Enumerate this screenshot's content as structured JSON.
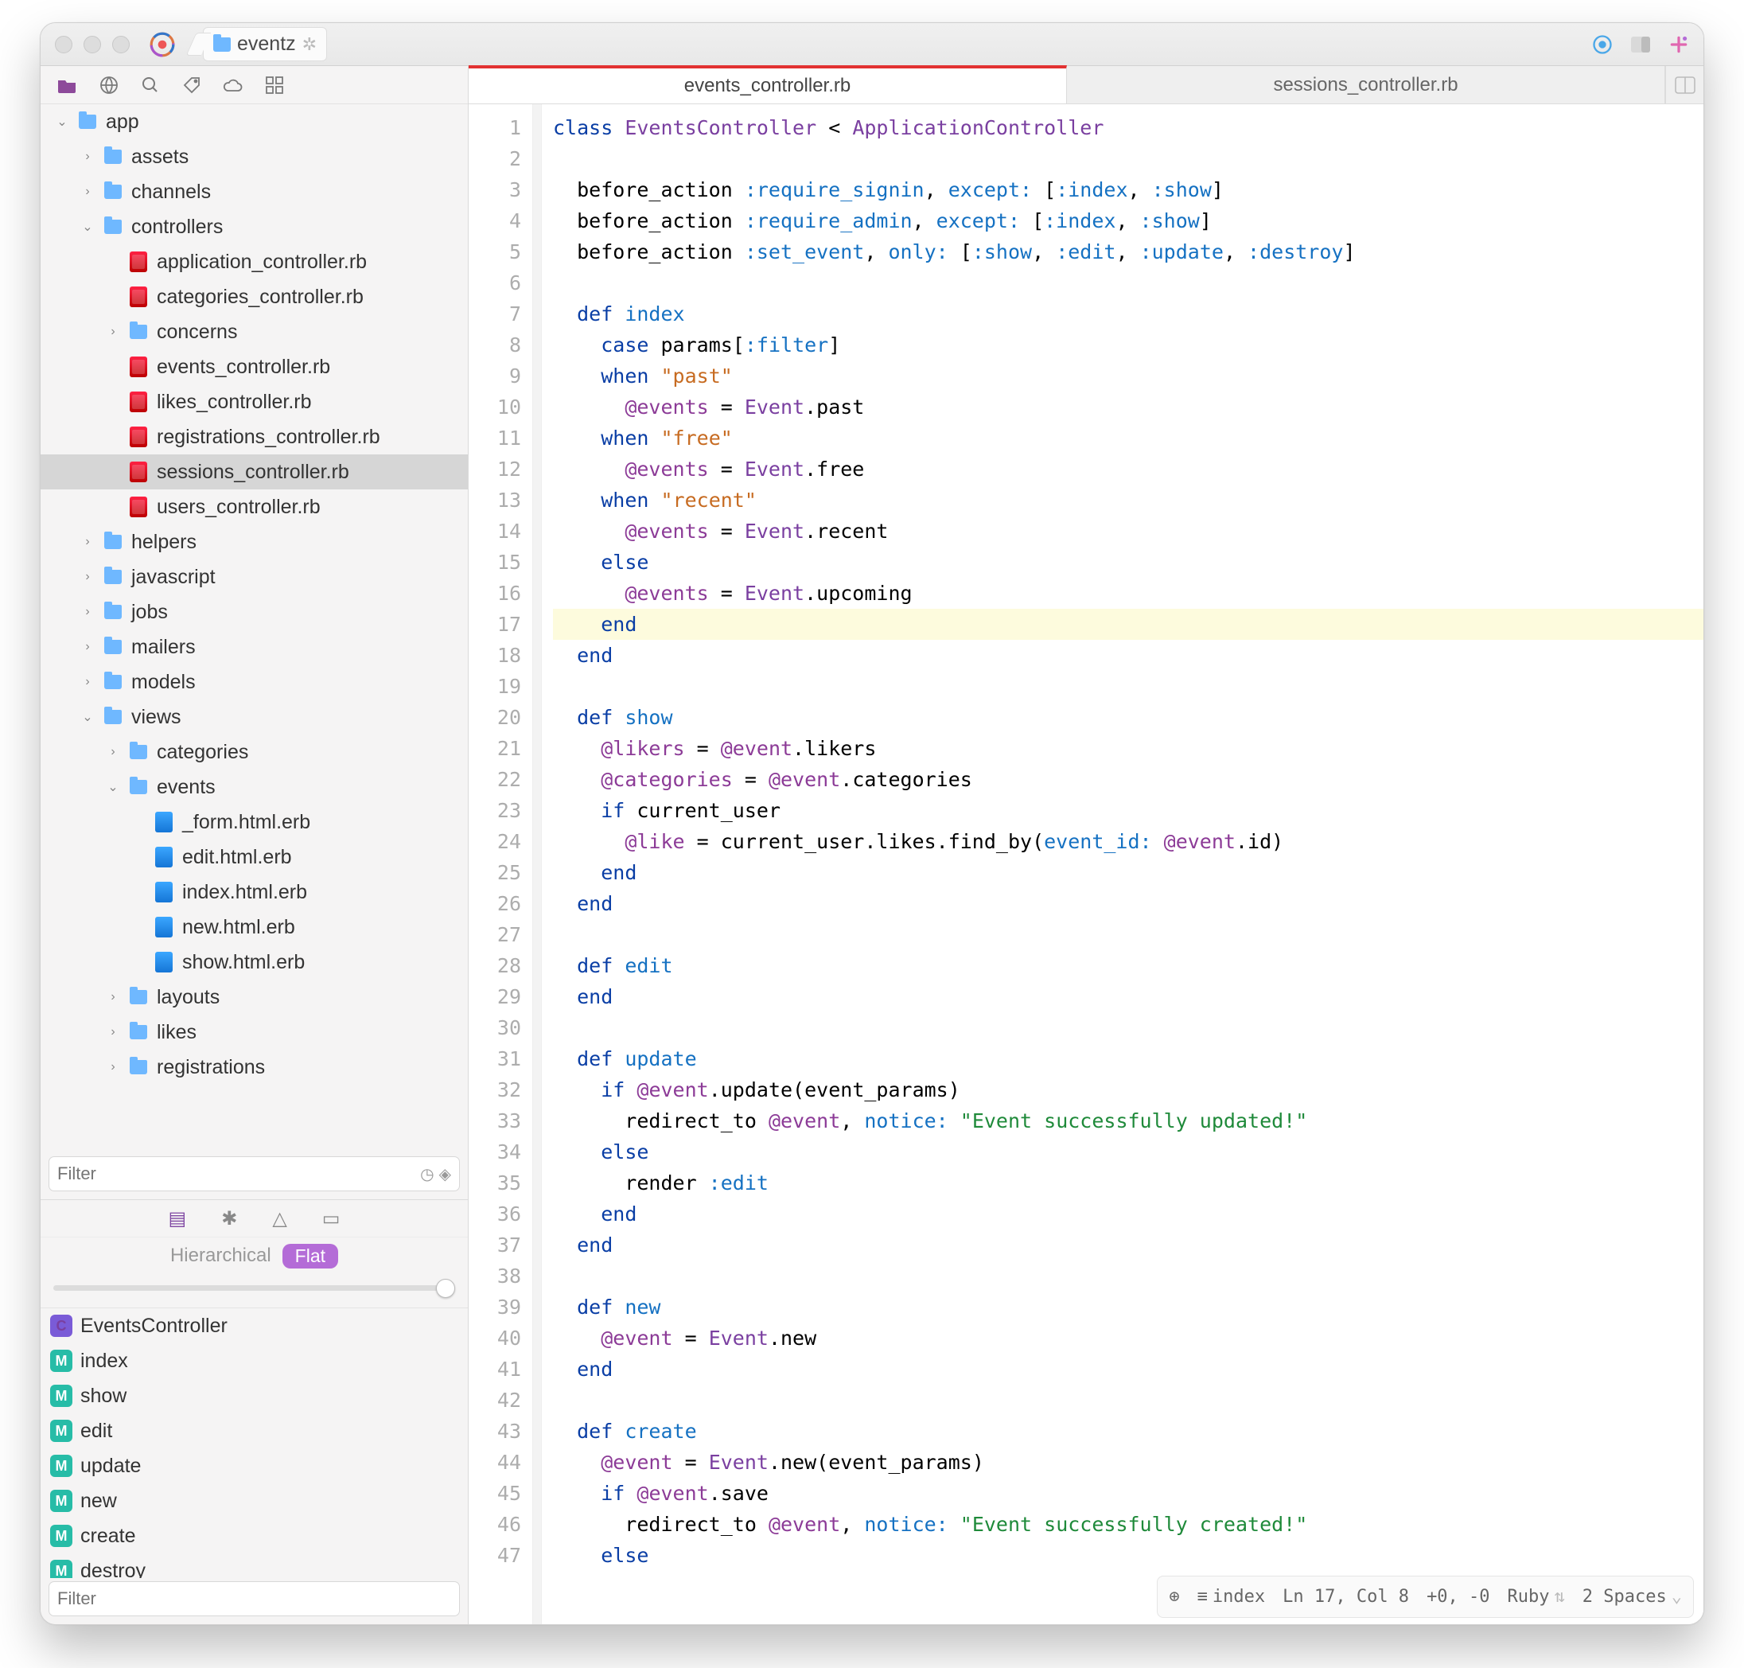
{
  "titlebar": {
    "project": "eventz"
  },
  "sidebar": {
    "filter_placeholder": "Filter",
    "struct_filter_placeholder": "Filter",
    "hierarchical_label": "Hierarchical",
    "flat_label": "Flat"
  },
  "tree": [
    {
      "d": 0,
      "t": "folder",
      "arrow": "down",
      "label": "app"
    },
    {
      "d": 1,
      "t": "folder",
      "arrow": "right",
      "label": "assets"
    },
    {
      "d": 1,
      "t": "folder",
      "arrow": "right",
      "label": "channels"
    },
    {
      "d": 1,
      "t": "folder",
      "arrow": "down",
      "label": "controllers"
    },
    {
      "d": 2,
      "t": "rb",
      "arrow": "none",
      "label": "application_controller.rb"
    },
    {
      "d": 2,
      "t": "rb",
      "arrow": "none",
      "label": "categories_controller.rb"
    },
    {
      "d": 2,
      "t": "folder",
      "arrow": "right",
      "label": "concerns"
    },
    {
      "d": 2,
      "t": "rb",
      "arrow": "none",
      "label": "events_controller.rb"
    },
    {
      "d": 2,
      "t": "rb",
      "arrow": "none",
      "label": "likes_controller.rb"
    },
    {
      "d": 2,
      "t": "rb",
      "arrow": "none",
      "label": "registrations_controller.rb"
    },
    {
      "d": 2,
      "t": "rb",
      "arrow": "none",
      "label": "sessions_controller.rb",
      "selected": true
    },
    {
      "d": 2,
      "t": "rb",
      "arrow": "none",
      "label": "users_controller.rb"
    },
    {
      "d": 1,
      "t": "folder",
      "arrow": "right",
      "label": "helpers"
    },
    {
      "d": 1,
      "t": "folder",
      "arrow": "right",
      "label": "javascript"
    },
    {
      "d": 1,
      "t": "folder",
      "arrow": "right",
      "label": "jobs"
    },
    {
      "d": 1,
      "t": "folder",
      "arrow": "right",
      "label": "mailers"
    },
    {
      "d": 1,
      "t": "folder",
      "arrow": "right",
      "label": "models"
    },
    {
      "d": 1,
      "t": "folder",
      "arrow": "down",
      "label": "views"
    },
    {
      "d": 2,
      "t": "folder",
      "arrow": "right",
      "label": "categories"
    },
    {
      "d": 2,
      "t": "folder",
      "arrow": "down",
      "label": "events"
    },
    {
      "d": 3,
      "t": "erb",
      "arrow": "none",
      "label": "_form.html.erb"
    },
    {
      "d": 3,
      "t": "erb",
      "arrow": "none",
      "label": "edit.html.erb"
    },
    {
      "d": 3,
      "t": "erb",
      "arrow": "none",
      "label": "index.html.erb"
    },
    {
      "d": 3,
      "t": "erb",
      "arrow": "none",
      "label": "new.html.erb"
    },
    {
      "d": 3,
      "t": "erb",
      "arrow": "none",
      "label": "show.html.erb"
    },
    {
      "d": 2,
      "t": "folder",
      "arrow": "right",
      "label": "layouts"
    },
    {
      "d": 2,
      "t": "folder",
      "arrow": "right",
      "label": "likes"
    },
    {
      "d": 2,
      "t": "folder",
      "arrow": "right",
      "label": "registrations"
    }
  ],
  "structure": [
    {
      "k": "cls",
      "label": "EventsController"
    },
    {
      "k": "mth",
      "label": "index"
    },
    {
      "k": "mth",
      "label": "show"
    },
    {
      "k": "mth",
      "label": "edit"
    },
    {
      "k": "mth",
      "label": "update"
    },
    {
      "k": "mth",
      "label": "new"
    },
    {
      "k": "mth",
      "label": "create"
    },
    {
      "k": "mth",
      "label": "destroy"
    }
  ],
  "tabs": {
    "t1": "events_controller.rb",
    "t2": "sessions_controller.rb"
  },
  "code_lines": [
    "<span class='kw'>class</span> <span class='cls'>EventsController</span> &lt; <span class='cls'>ApplicationController</span>",
    "",
    "  before_action <span class='sym'>:require_signin</span>, <span class='paramk'>except:</span> [<span class='sym'>:index</span>, <span class='sym'>:show</span>]",
    "  before_action <span class='sym'>:require_admin</span>, <span class='paramk'>except:</span> [<span class='sym'>:index</span>, <span class='sym'>:show</span>]",
    "  before_action <span class='sym'>:set_event</span>, <span class='paramk'>only:</span> [<span class='sym'>:show</span>, <span class='sym'>:edit</span>, <span class='sym'>:update</span>, <span class='sym'>:destroy</span>]",
    "",
    "  <span class='kw'>def</span> <span class='sym'>index</span>",
    "    <span class='kw'>case</span> params[<span class='sym'>:filter</span>]",
    "    <span class='kw'>when</span> <span class='strn'>\"past\"</span>",
    "      <span class='ivar'>@events</span> = <span class='cls'>Event</span>.past",
    "    <span class='kw'>when</span> <span class='strn'>\"free\"</span>",
    "      <span class='ivar'>@events</span> = <span class='cls'>Event</span>.free",
    "    <span class='kw'>when</span> <span class='strn'>\"recent\"</span>",
    "      <span class='ivar'>@events</span> = <span class='cls'>Event</span>.recent",
    "    <span class='kw'>else</span>",
    "      <span class='ivar'>@events</span> = <span class='cls'>Event</span>.upcoming",
    "    <span class='kw'>end</span>",
    "  <span class='kw'>end</span>",
    "",
    "  <span class='kw'>def</span> <span class='sym'>show</span>",
    "    <span class='ivar'>@likers</span> = <span class='ivar'>@event</span>.likers",
    "    <span class='ivar'>@categories</span> = <span class='ivar'>@event</span>.categories",
    "    <span class='kw'>if</span> current_user",
    "      <span class='ivar'>@like</span> = current_user.likes.find_by(<span class='paramk'>event_id:</span> <span class='ivar'>@event</span>.id)",
    "    <span class='kw'>end</span>",
    "  <span class='kw'>end</span>",
    "",
    "  <span class='kw'>def</span> <span class='sym'>edit</span>",
    "  <span class='kw'>end</span>",
    "",
    "  <span class='kw'>def</span> <span class='sym'>update</span>",
    "    <span class='kw'>if</span> <span class='ivar'>@event</span>.update(event_params)",
    "      redirect_to <span class='ivar'>@event</span>, <span class='paramk'>notice:</span> <span class='str'>\"Event successfully updated!\"</span>",
    "    <span class='kw'>else</span>",
    "      render <span class='sym'>:edit</span>",
    "    <span class='kw'>end</span>",
    "  <span class='kw'>end</span>",
    "",
    "  <span class='kw'>def</span> <span class='sym'>new</span>",
    "    <span class='ivar'>@event</span> = <span class='cls'>Event</span>.new",
    "  <span class='kw'>end</span>",
    "",
    "  <span class='kw'>def</span> <span class='sym'>create</span>",
    "    <span class='ivar'>@event</span> = <span class='cls'>Event</span>.new(event_params)",
    "    <span class='kw'>if</span> <span class='ivar'>@event</span>.save",
    "      redirect_to <span class='ivar'>@event</span>, <span class='paramk'>notice:</span> <span class='str'>\"Event successfully created!\"</span>",
    "    <span class='kw'>else</span>"
  ],
  "status": {
    "context": "index",
    "pos": "Ln 17, Col 8",
    "sel": "+0, -0",
    "lang": "Ruby",
    "indent": "2 Spaces"
  }
}
